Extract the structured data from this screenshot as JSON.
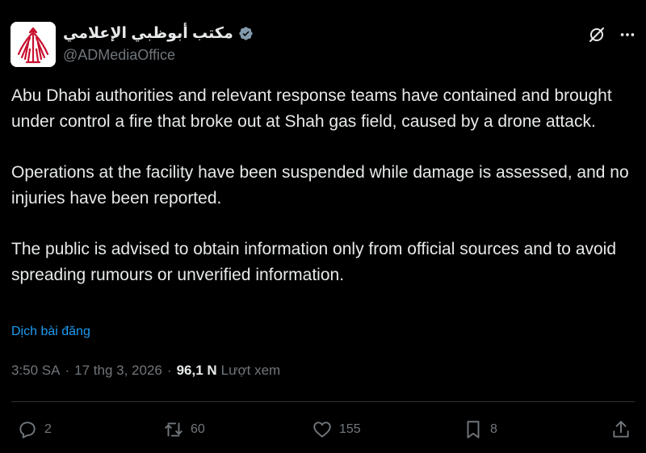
{
  "header": {
    "display_name": "مكتب أبوظبي الإعلامي",
    "handle": "@ADMediaOffice",
    "verified_icon": "verified-badge-icon",
    "grok_icon": "grok-icon",
    "more_icon": "more-icon"
  },
  "tweet": {
    "paragraphs": [
      "Abu Dhabi authorities and relevant response teams have contained and brought under control a fire that broke out at Shah gas field, caused by a drone attack.",
      "Operations at the facility have been suspended while damage is assessed, and no injuries have been reported.",
      "The public is advised to obtain information only from official sources and to avoid spreading rumours or unverified information."
    ],
    "translate_label": "Dịch bài đăng"
  },
  "meta": {
    "time": "3:50 SA",
    "date": "17 thg 3, 2026",
    "views_count": "96,1 N",
    "views_label": "Lượt xem"
  },
  "actions": {
    "replies": "2",
    "reposts": "60",
    "likes": "155",
    "bookmarks": "8"
  },
  "colors": {
    "background": "#000000",
    "text": "#e7e9ea",
    "muted": "#71767b",
    "link": "#1d9bf0",
    "avatar_red": "#c8102e"
  }
}
